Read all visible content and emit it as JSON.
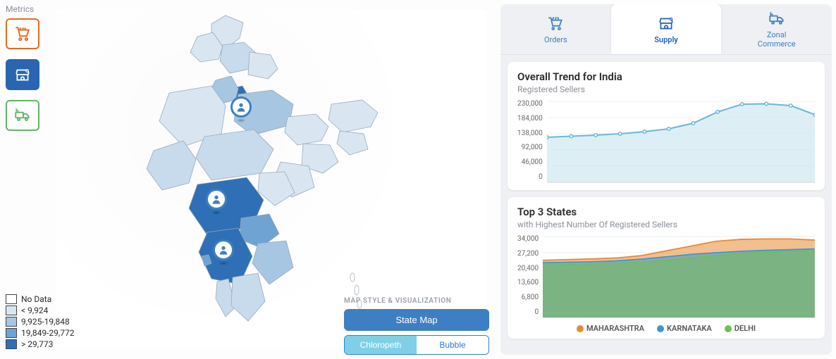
{
  "metrics": {
    "title": "Metrics",
    "items": [
      {
        "name": "orders",
        "label": "Orders"
      },
      {
        "name": "supply",
        "label": "Supply"
      },
      {
        "name": "zonal",
        "label": "Zonal Commerce"
      }
    ]
  },
  "legend": {
    "items": [
      {
        "color": "#ffffff",
        "label": "No Data"
      },
      {
        "color": "#d9e6f2",
        "label": "< 9,924"
      },
      {
        "color": "#a7c6e2",
        "label": "9,925-19,848"
      },
      {
        "color": "#6fa3d3",
        "label": "19,849-29,772"
      },
      {
        "color": "#2f6fb5",
        "label": "> 29,773"
      }
    ]
  },
  "map_controls": {
    "header": "MAP STYLE & VISUALIZATION",
    "state_map_label": "State Map",
    "toggle": {
      "chloropeth": "Chloropeth",
      "bubble": "Bubble",
      "active": "chloropeth"
    }
  },
  "tabs": {
    "orders_label": "Orders",
    "supply_label": "Supply",
    "zonal_label_line1": "Zonal",
    "zonal_label_line2": "Commerce",
    "active": "supply"
  },
  "trend_card": {
    "title": "Overall Trend for India",
    "subtitle": "Registered Sellers"
  },
  "top3_card": {
    "title": "Top 3 States",
    "subtitle": "with Highest Number Of Registered Sellers",
    "series_labels": [
      "MAHARASHTRA",
      "KARNATAKA",
      "DELHI"
    ],
    "series_colors": [
      "#e78b33",
      "#3d94d6",
      "#6cbf57"
    ]
  },
  "chart_data": [
    {
      "id": "overall_trend",
      "type": "area",
      "title": "Overall Trend for India",
      "subtitle": "Registered Sellers",
      "ylabel": "Registered Sellers",
      "ylim": [
        0,
        230000
      ],
      "yticks": [
        0,
        46000,
        92000,
        138000,
        184000,
        230000
      ],
      "ytick_labels": [
        "0",
        "46,000",
        "92,000",
        "138,000",
        "184,000",
        "230,000"
      ],
      "x": [
        0,
        1,
        2,
        3,
        4,
        5,
        6,
        7,
        8,
        9,
        10,
        11
      ],
      "values": [
        128000,
        131000,
        134000,
        138000,
        144000,
        152000,
        168000,
        200000,
        222000,
        223000,
        218000,
        192000
      ],
      "color": "#6ab7d9",
      "fill": "#cfe8f1"
    },
    {
      "id": "top3_states",
      "type": "area",
      "title": "Top 3 States",
      "subtitle": "with Highest Number Of Registered Sellers",
      "ylabel": "Registered Sellers",
      "ylim": [
        0,
        34000
      ],
      "yticks": [
        0,
        6800,
        13600,
        20400,
        27200,
        34000
      ],
      "ytick_labels": [
        "0",
        "6,800",
        "13,600",
        "20,400",
        "27,200",
        "34,000"
      ],
      "x": [
        0,
        1,
        2,
        3,
        4,
        5,
        6,
        7,
        8,
        9,
        10,
        11
      ],
      "series": [
        {
          "name": "MAHARASHTRA",
          "color": "#e78b33",
          "values": [
            24000,
            24300,
            24600,
            25000,
            26000,
            28000,
            30000,
            32000,
            32800,
            33000,
            33000,
            32500
          ]
        },
        {
          "name": "KARNATAKA",
          "color": "#3d94d6",
          "values": [
            23000,
            23200,
            23400,
            23800,
            24500,
            25500,
            26500,
            27200,
            27800,
            28200,
            28500,
            28800
          ]
        },
        {
          "name": "DELHI",
          "color": "#6cbf57",
          "values": [
            22000,
            22200,
            22400,
            22800,
            23200,
            24000,
            25000,
            26000,
            26800,
            27400,
            27800,
            28000
          ]
        }
      ]
    }
  ]
}
